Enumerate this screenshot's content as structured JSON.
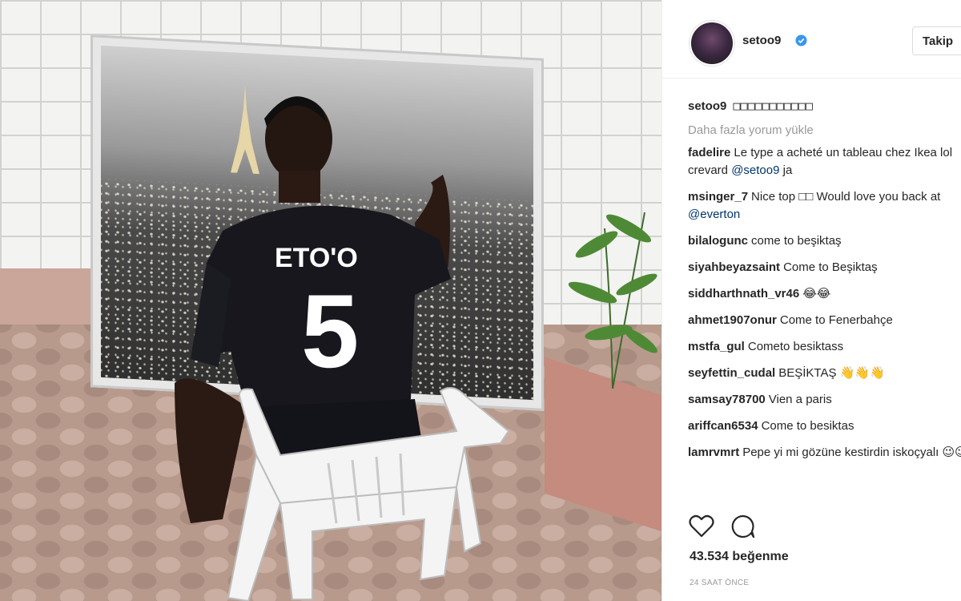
{
  "post": {
    "username": "setoo9",
    "verified": true,
    "follow_label": "Takip",
    "caption_user": "setoo9",
    "caption_text": "□□□□□□□□□□□",
    "load_more_label": "Daha fazla yorum yükle",
    "comments": [
      {
        "user": "fadelire",
        "text": "Le type a acheté un tableau chez Ikea lol crevard ",
        "mention": "@setoo9",
        "after": " ja"
      },
      {
        "user": "msinger_7",
        "text": "Nice top □□ Would love you back at ",
        "mention": "@everton",
        "after": ""
      },
      {
        "user": "bilalogunc",
        "text": "come to beşiktaş",
        "mention": "",
        "after": ""
      },
      {
        "user": "siyahbeyazsaint",
        "text": "Come to Beşiktaş",
        "mention": "",
        "after": ""
      },
      {
        "user": "siddharthnath_vr46",
        "text": "😂😂",
        "mention": "",
        "after": ""
      },
      {
        "user": "ahmet1907onur",
        "text": "Come to Fenerbahçe",
        "mention": "",
        "after": ""
      },
      {
        "user": "mstfa_gul",
        "text": "Cometo besiktass",
        "mention": "",
        "after": ""
      },
      {
        "user": "seyfettin_cudal",
        "text": "BEŞİKTAŞ 👋👋👋",
        "mention": "",
        "after": ""
      },
      {
        "user": "samsay78700",
        "text": "Vien a paris",
        "mention": "",
        "after": ""
      },
      {
        "user": "ariffcan6534",
        "text": "Come to besiktas",
        "mention": "",
        "after": ""
      },
      {
        "user": "lamrvmrt",
        "text": "Pepe yi mi gözüne kestirdin iskoçyalı 😉😉",
        "mention": "",
        "after": ""
      }
    ],
    "likes_label": "43.534 beğenme",
    "timestamp": "24 SAAT ÖNCE",
    "icons": {
      "like": "heart-icon",
      "comment": "comment-bubble-icon",
      "verified": "verified-badge-icon"
    },
    "colors": {
      "verified": "#3897f0",
      "mention": "#003569",
      "muted": "#999999"
    }
  },
  "photo": {
    "jersey_name": "ETO'O",
    "jersey_number": "5"
  }
}
